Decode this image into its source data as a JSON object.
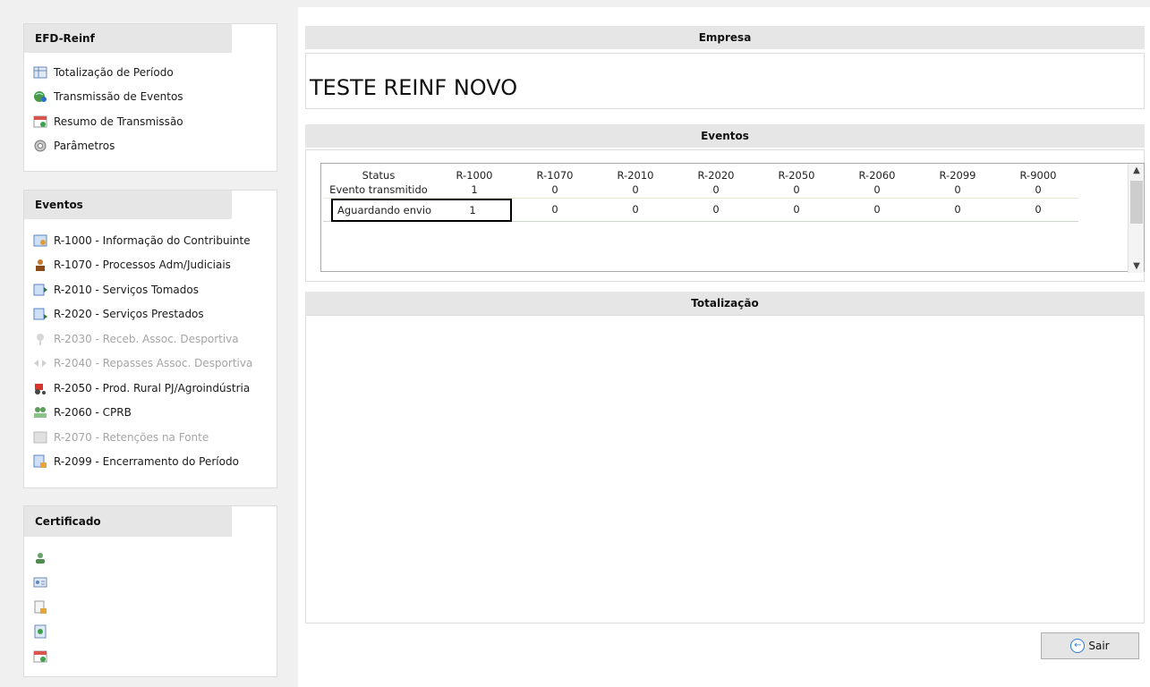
{
  "sidebar": {
    "efd_title": "EFD-Reinf",
    "efd_items": [
      {
        "label": "Totalização de Período",
        "icon": "table-icon"
      },
      {
        "label": "Transmissão de Eventos",
        "icon": "globe-icon"
      },
      {
        "label": "Resumo de Transmissão",
        "icon": "summary-icon"
      },
      {
        "label": "Parâmetros",
        "icon": "gear-icon"
      }
    ],
    "eventos_title": "Eventos",
    "eventos_items": [
      {
        "label": "R-1000 - Informação do Contribuinte",
        "icon": "contributor-icon",
        "enabled": true
      },
      {
        "label": "R-1070 - Processos Adm/Judiciais",
        "icon": "judge-icon",
        "enabled": true
      },
      {
        "label": "R-2010 - Serviços Tomados",
        "icon": "services-taken-icon",
        "enabled": true
      },
      {
        "label": "R-2020 - Serviços Prestados",
        "icon": "services-provided-icon",
        "enabled": true
      },
      {
        "label": "R-2030 - Receb. Assoc. Desportiva",
        "icon": "trophy-icon",
        "enabled": false
      },
      {
        "label": "R-2040 - Repasses Assoc. Desportiva",
        "icon": "transfer-icon",
        "enabled": false
      },
      {
        "label": "R-2050 - Prod. Rural PJ/Agroindústria",
        "icon": "tractor-icon",
        "enabled": true
      },
      {
        "label": "R-2060 - CPRB",
        "icon": "people-icon",
        "enabled": true
      },
      {
        "label": "R-2070 - Retenções na Fonte",
        "icon": "retention-icon",
        "enabled": false
      },
      {
        "label": "R-2099 - Encerramento do Período",
        "icon": "closing-icon",
        "enabled": true
      }
    ],
    "certificado_title": "Certificado",
    "certificado_icons": [
      "user-icon",
      "id-card-icon",
      "lock-icon",
      "certificate-icon",
      "calendar-icon"
    ]
  },
  "empresa": {
    "header": "Empresa",
    "name": "TESTE REINF NOVO"
  },
  "eventos": {
    "header": "Eventos",
    "columns": [
      "Status",
      "R-1000",
      "R-1070",
      "R-2010",
      "R-2020",
      "R-2050",
      "R-2060",
      "R-2099",
      "R-9000"
    ],
    "rows": [
      [
        "Evento transmitido",
        "1",
        "0",
        "0",
        "0",
        "0",
        "0",
        "0",
        "0"
      ],
      [
        "Aguardando envio",
        "1",
        "0",
        "0",
        "0",
        "0",
        "0",
        "0",
        "0"
      ]
    ]
  },
  "totalizacao": {
    "header": "Totalização"
  },
  "buttons": {
    "sair": "Sair"
  }
}
